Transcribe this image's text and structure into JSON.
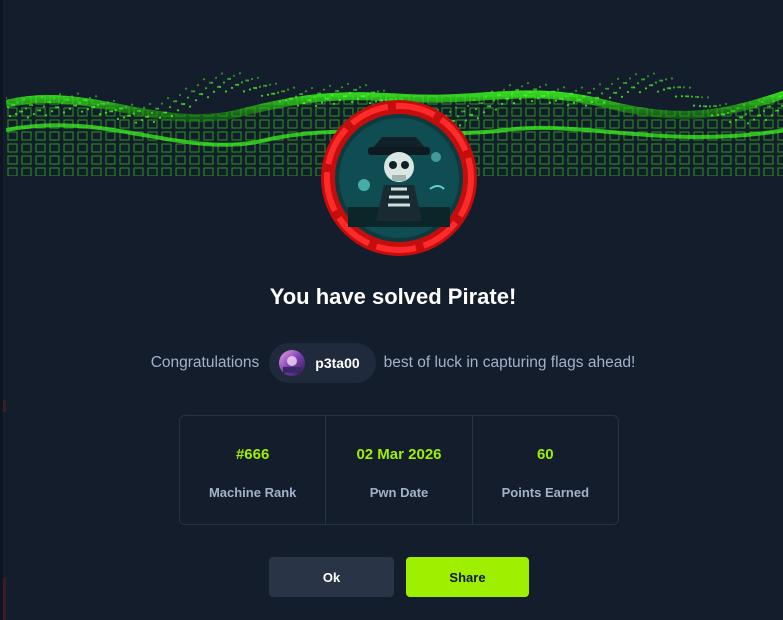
{
  "modal": {
    "title": "You have solved Pirate!",
    "congrats_prefix": "Congratulations",
    "username": "p3ta00",
    "congrats_suffix": "best of luck in capturing flags ahead!"
  },
  "stats": [
    {
      "value": "#666",
      "label": "Machine Rank"
    },
    {
      "value": "02 Mar 2026",
      "label": "Pwn Date"
    },
    {
      "value": "60",
      "label": "Points Earned"
    }
  ],
  "buttons": {
    "ok_label": "Ok",
    "share_label": "Share"
  },
  "colors": {
    "accent": "#9fef00",
    "badge_ring": "#e10f0f",
    "background": "#141d2b"
  },
  "icons": {
    "badge": "pirate-skeleton-badge",
    "avatar": "user-avatar"
  }
}
